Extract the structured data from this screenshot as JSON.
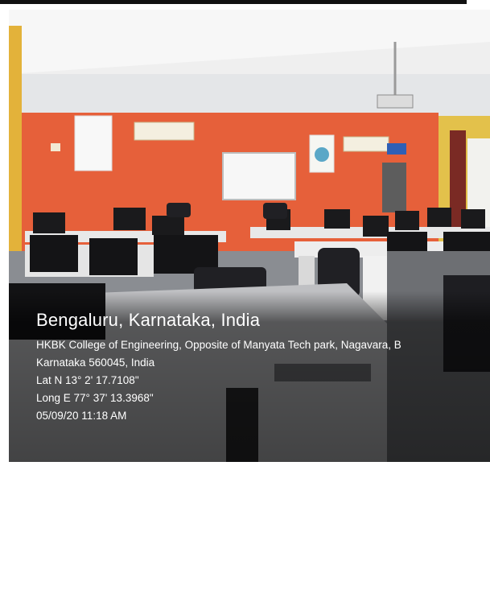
{
  "photo": {
    "caption": {
      "city": "Bengaluru, Karnataka, India",
      "address_line1": "HKBK College of Engineering, Opposite of Manyata Tech park, Nagavara, B",
      "address_line2": "Karnataka 560045, India",
      "latitude": "Lat N 13° 2' 17.7108\"",
      "longitude": "Long E 77° 37' 13.3968\"",
      "timestamp": "05/09/20 11:18 AM"
    },
    "colors": {
      "wall": "#e8603a",
      "ceiling": "#f1f1f1",
      "pillar": "#e3b23a"
    }
  }
}
